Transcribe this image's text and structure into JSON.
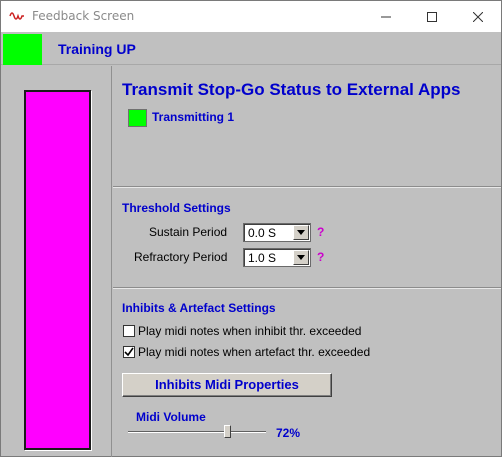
{
  "window": {
    "title": "Feedback Screen"
  },
  "header": {
    "status_text": "Training UP",
    "status_color": "#00ff00"
  },
  "feedback_bar": {
    "color": "#ff00ff"
  },
  "transmit": {
    "title": "Transmit Stop-Go Status to External Apps",
    "status_label": "Transmitting 1",
    "status_color": "#00ff00"
  },
  "threshold": {
    "title": "Threshold Settings",
    "sustain_label": "Sustain Period",
    "sustain_value": "0.0 S",
    "refractory_label": "Refractory Period",
    "refractory_value": "1.0 S",
    "help_text": "?"
  },
  "inhibits": {
    "title": "Inhibits & Artefact Settings",
    "checkboxes": [
      {
        "label": "Play midi notes when inhibit thr. exceeded",
        "checked": false
      },
      {
        "label": "Play midi notes when artefact thr. exceeded",
        "checked": true
      }
    ],
    "midi_button_label": "Inhibits Midi Properties",
    "volume_label": "Midi Volume",
    "volume_value": "72%",
    "volume_fraction": 0.72
  },
  "colors": {
    "accent_text": "#0000cc",
    "help": "#cc00cc",
    "panel": "#c0c0c0"
  },
  "icons": [
    "app-waveform-icon",
    "minimize-icon",
    "maximize-icon",
    "close-icon",
    "chevron-down-icon",
    "checkmark-icon"
  ]
}
